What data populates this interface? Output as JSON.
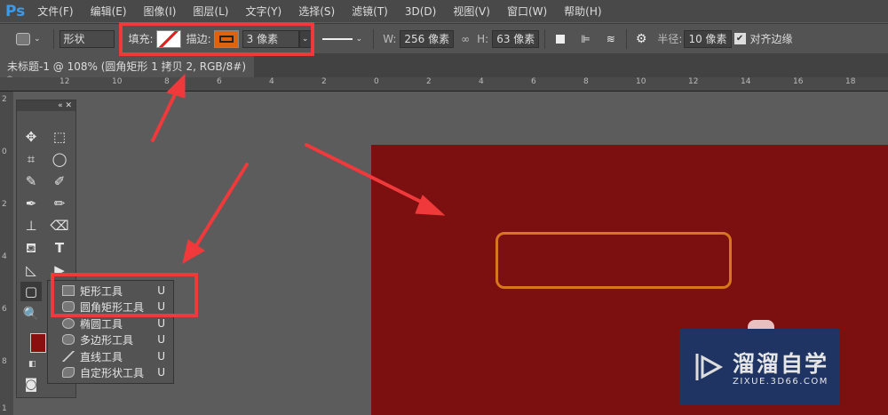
{
  "app": {
    "logo": "Ps"
  },
  "menu": [
    "文件(F)",
    "编辑(E)",
    "图像(I)",
    "图层(L)",
    "文字(Y)",
    "选择(S)",
    "滤镜(T)",
    "3D(D)",
    "视图(V)",
    "窗口(W)",
    "帮助(H)"
  ],
  "options": {
    "mode": "形状",
    "fill_label": "填充:",
    "stroke_label": "描边:",
    "stroke_width": "3 像素",
    "w_label": "W:",
    "w_value": "256 像素",
    "h_label": "H:",
    "h_value": "63 像素",
    "radius_label": "半径:",
    "radius_value": "10 像素",
    "align_edges": "对齐边缘",
    "align_checked": true,
    "stroke_color": "#e0620c"
  },
  "document_tab": {
    "title": "未标题-1 @ 108% (圆角矩形 1 拷贝 2, RGB/8#) *",
    "close": "×"
  },
  "ruler": {
    "h": [
      "12",
      "10",
      "8",
      "6",
      "4",
      "2",
      "0",
      "2",
      "4",
      "6",
      "8",
      "10",
      "12",
      "14",
      "16",
      "18"
    ],
    "v": [
      "2",
      "0",
      "2",
      "4",
      "6",
      "8",
      "1"
    ]
  },
  "toolbox": {
    "foreground_color": "#8a1010"
  },
  "flyout": [
    {
      "label": "矩形工具",
      "key": "U"
    },
    {
      "label": "圆角矩形工具",
      "key": "U"
    },
    {
      "label": "椭圆工具",
      "key": "U"
    },
    {
      "label": "多边形工具",
      "key": "U"
    },
    {
      "label": "直线工具",
      "key": "U"
    },
    {
      "label": "自定形状工具",
      "key": "U"
    }
  ],
  "canvas": {
    "bg": "#7c0f0f",
    "shape_stroke": "#d8761e"
  },
  "watermark": {
    "name": "溜溜自学",
    "url": "ZIXUE.3D66.COM"
  }
}
